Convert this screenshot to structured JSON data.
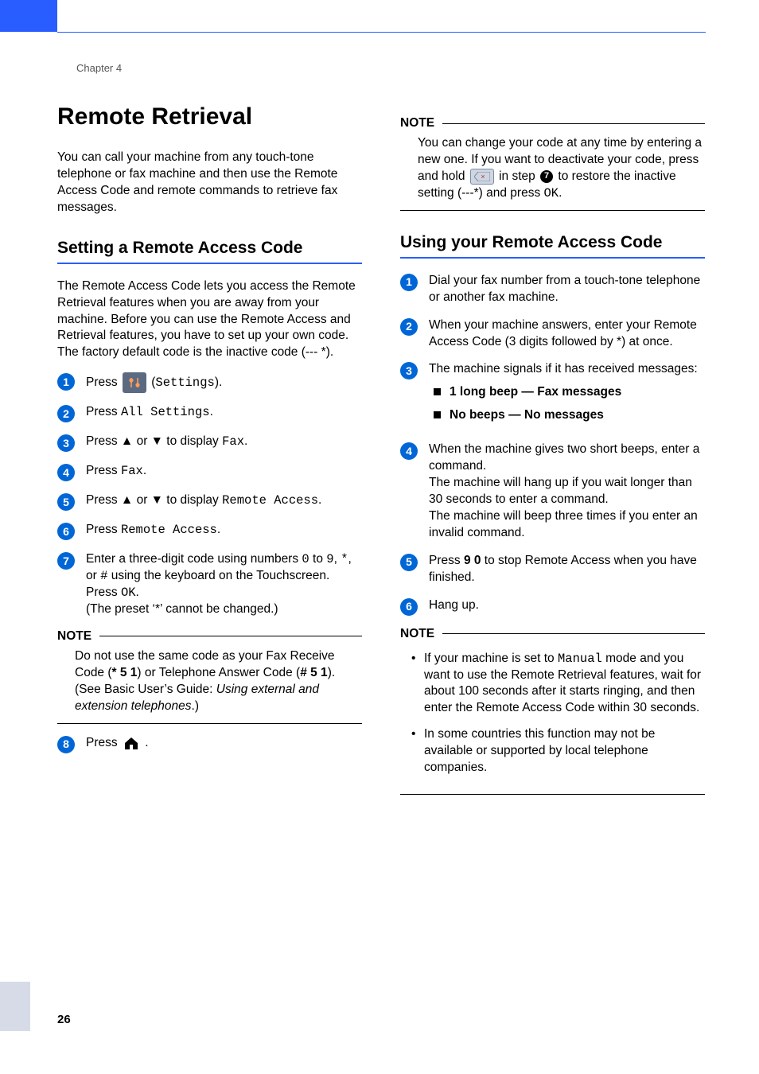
{
  "chapter": "Chapter 4",
  "page_number": "26",
  "title": "Remote Retrieval",
  "intro": "You can call your machine from any touch-tone telephone or fax machine and then use the Remote Access Code and remote commands to retrieve fax messages.",
  "left": {
    "heading": "Setting a Remote Access Code",
    "para": "The Remote Access Code lets you access the Remote Retrieval features when you are away from your machine. Before you can use the Remote Access and Retrieval features, you have to set up your own code. The factory default code is the inactive code (--- *).",
    "steps": {
      "s1a": "Press ",
      "s1b": " (",
      "s1code": "Settings",
      "s1c": ").",
      "s2a": "Press ",
      "s2code": "All Settings",
      "s2b": ".",
      "s3a": "Press ▲ or ▼ to display ",
      "s3code": "Fax",
      "s3b": ".",
      "s4a": "Press ",
      "s4code": "Fax",
      "s4b": ".",
      "s5a": "Press ▲ or ▼ to display ",
      "s5code": "Remote Access",
      "s5b": ".",
      "s6a": "Press ",
      "s6code": "Remote Access",
      "s6b": ".",
      "s7a": "Enter a three-digit code using numbers ",
      "s7code1": "0",
      "s7b": " to ",
      "s7code2": "9",
      "s7c": ", ",
      "s7code3": "*",
      "s7d": ", or ",
      "s7code4": "#",
      "s7e": " using the keyboard on the Touchscreen.",
      "s7f": "Press ",
      "s7code5": "OK",
      "s7g": ".",
      "s7h": "(The preset ‘*’ cannot be changed.)",
      "s8a": "Press ",
      "s8b": "."
    },
    "note_label": "NOTE",
    "note_a": "Do not use the same code as your Fax Receive Code (",
    "note_code1": "* 5 1",
    "note_b": ") or Telephone Answer Code (",
    "note_code2": "# 5 1",
    "note_c": "). (See Basic User’s Guide: ",
    "note_ital": "Using external and extension telephones",
    "note_d": ".)"
  },
  "right": {
    "note1_label": "NOTE",
    "note1_a": "You can change your code at any time by entering a new one. If you want to deactivate your code, press and hold ",
    "note1_b": " in step ",
    "note1_badge": "7",
    "note1_c": " to restore the inactive setting (---*) and press ",
    "note1_code": "OK",
    "note1_d": ".",
    "heading": "Using your Remote Access Code",
    "steps": {
      "s1": "Dial your fax number from a touch-tone telephone or another fax machine.",
      "s2": "When your machine answers, enter your Remote Access Code (3 digits followed by *) at once.",
      "s3": "The machine signals if it has received messages:",
      "s3_b1": "1 long beep — Fax messages",
      "s3_b2": "No beeps — No messages",
      "s4a": "When the machine gives two short beeps, enter a command.",
      "s4b": "The machine will hang up if you wait longer than 30 seconds to enter a command.",
      "s4c": "The machine will beep three times if you enter an invalid command.",
      "s5a": "Press ",
      "s5bold": "9 0",
      "s5b": " to stop Remote Access when you have finished.",
      "s6": "Hang up."
    },
    "note2_label": "NOTE",
    "note2_li1a": "If your machine is set to ",
    "note2_li1code": "Manual",
    "note2_li1b": " mode and you want to use the Remote Retrieval features, wait for about 100 seconds after it starts ringing, and then enter the Remote Access Code within 30 seconds.",
    "note2_li2": "In some countries this function may not be available or supported by local telephone companies."
  }
}
